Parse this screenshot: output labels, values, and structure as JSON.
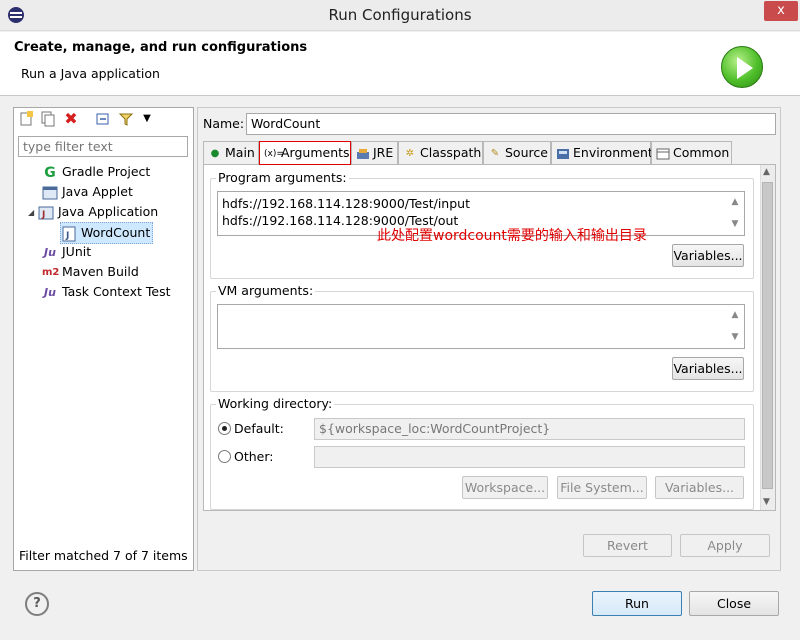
{
  "window": {
    "title": "Run Configurations",
    "close_label": "x"
  },
  "header": {
    "title": "Create, manage, and run configurations",
    "subtitle": "Run a Java application"
  },
  "sidebar": {
    "filter_placeholder": "type filter text",
    "items": [
      {
        "label": "Gradle Project",
        "icon": "gradle-icon"
      },
      {
        "label": "Java Applet",
        "icon": "java-applet-icon"
      },
      {
        "label": "Java Application",
        "icon": "java-application-icon",
        "expanded": true
      },
      {
        "label": "WordCount",
        "icon": "java-class-icon",
        "selected": true
      },
      {
        "label": "JUnit",
        "icon": "junit-icon"
      },
      {
        "label": "Maven Build",
        "icon": "maven-icon"
      },
      {
        "label": "Task Context Test",
        "icon": "junit-icon"
      }
    ],
    "status": "Filter matched 7 of 7 items"
  },
  "config": {
    "name_label": "Name:",
    "name_value": "WordCount",
    "tabs": [
      {
        "label": "Main",
        "icon": "main-icon"
      },
      {
        "label": "Arguments",
        "icon": "arguments-icon",
        "active": true
      },
      {
        "label": "JRE",
        "icon": "jre-icon"
      },
      {
        "label": "Classpath",
        "icon": "classpath-icon"
      },
      {
        "label": "Source",
        "icon": "source-icon"
      },
      {
        "label": "Environment",
        "icon": "environment-icon"
      },
      {
        "label": "Common",
        "icon": "common-icon"
      }
    ],
    "program_args_label": "Program arguments:",
    "program_args_lines": [
      "hdfs://192.168.114.128:9000/Test/input",
      "hdfs://192.168.114.128:9000/Test/out"
    ],
    "annotation": "此处配置wordcount需要的输入和输出目录",
    "variables_label": "Variables...",
    "vm_args_label": "VM arguments:",
    "vm_args_value": "",
    "working_dir_label": "Working directory:",
    "default_label": "Default:",
    "default_value": "${workspace_loc:WordCountProject}",
    "other_label": "Other:",
    "other_value": "",
    "workspace_btn": "Workspace...",
    "filesystem_btn": "File System...",
    "wd_variables_btn": "Variables..."
  },
  "actions": {
    "revert": "Revert",
    "apply": "Apply",
    "run": "Run",
    "close": "Close",
    "help": "?"
  },
  "colors": {
    "annotation": "#e00000",
    "highlight_box": "#e00000",
    "selection": "#cde8ff"
  }
}
